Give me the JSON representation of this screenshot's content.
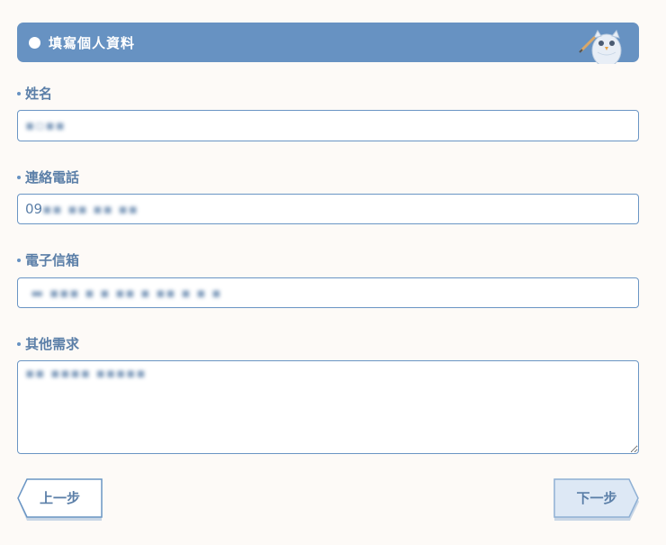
{
  "header": {
    "title": "填寫個人資料",
    "mascot_icon": "owl-mascot-icon"
  },
  "form": {
    "name": {
      "label": "姓名",
      "value": "▪▫▪▪"
    },
    "phone": {
      "label": "連絡電話",
      "value_prefix": "09",
      "value_masked": "▪▪  ▪▪ ▪▪  ▪▪"
    },
    "email": {
      "label": "電子信箱",
      "value": "▬  ▪▪▪  ▪ ▪ ▪▪ ▪ ▪▪ ▪  ▪  ▪"
    },
    "notes": {
      "label": "其他需求",
      "value": "▪▪ ▪▪▪▪ ▪▪▪▪▪"
    }
  },
  "nav": {
    "prev_label": "上一步",
    "next_label": "下一步"
  },
  "colors": {
    "accent": "#6792c2",
    "text": "#5b7fa8",
    "background": "#fdfaf7",
    "next_fill": "#dde8f5"
  }
}
